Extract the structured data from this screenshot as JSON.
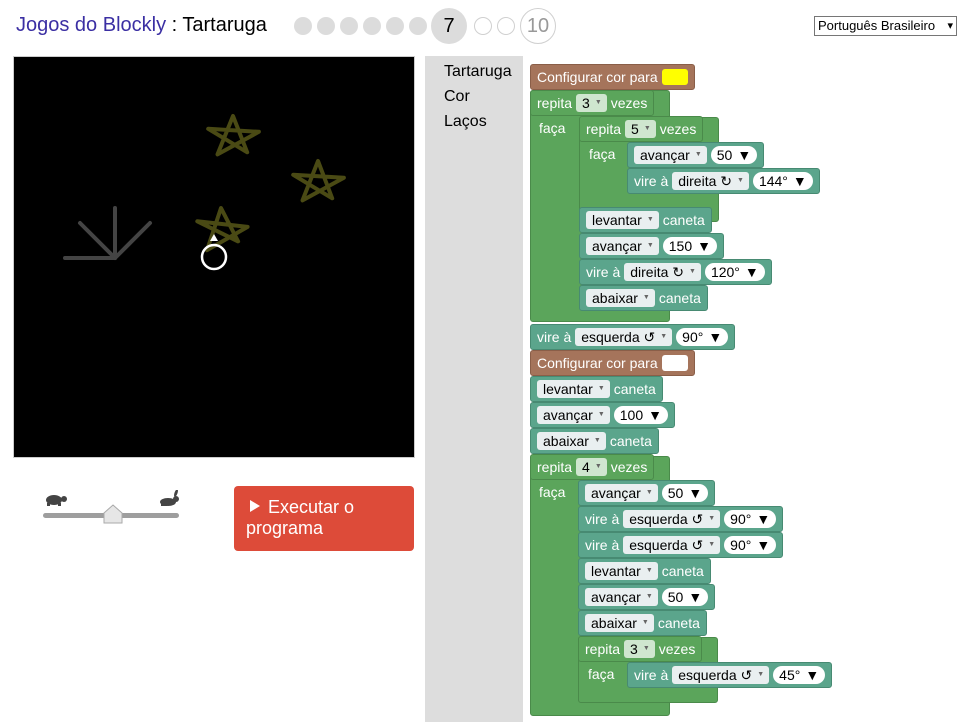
{
  "header": {
    "app_name": "Jogos do Blockly",
    "separator": " : ",
    "game_name": "Tartaruga",
    "current_level": "7",
    "last_level": "10",
    "language": "Português Brasileiro"
  },
  "controls": {
    "run_button_label": "Executar o programa"
  },
  "toolbox": {
    "categories": [
      "Tartaruga",
      "Cor",
      "Laços"
    ]
  },
  "blocks": {
    "set_colour": "Configurar cor para",
    "repeat": "repita",
    "times": "vezes",
    "do": "faça",
    "forward": "avançar",
    "turn": "vire à",
    "right": "direita ↻",
    "left": "esquerda ↺",
    "pen_up": "levantar",
    "pen_down": "abaixar",
    "pen": "caneta",
    "colour_1": "#ffff00",
    "colour_2": "#ffffff",
    "v_outer_repeat": "3",
    "v_inner_repeat": "5",
    "v_fwd_50": "50",
    "v_turn_144": "144°",
    "v_fwd_150": "150",
    "v_turn_120": "120°",
    "v_turn_90": "90°",
    "v_fwd_100": "100",
    "v_repeat_4": "4",
    "v_turn_45": "45°"
  },
  "colors": {
    "header_link": "#3b2fa3",
    "run_button": "#dd4b39",
    "loop_block": "#5ba55b",
    "turtle_block": "#5ba58c",
    "colour_block": "#a5745b"
  }
}
